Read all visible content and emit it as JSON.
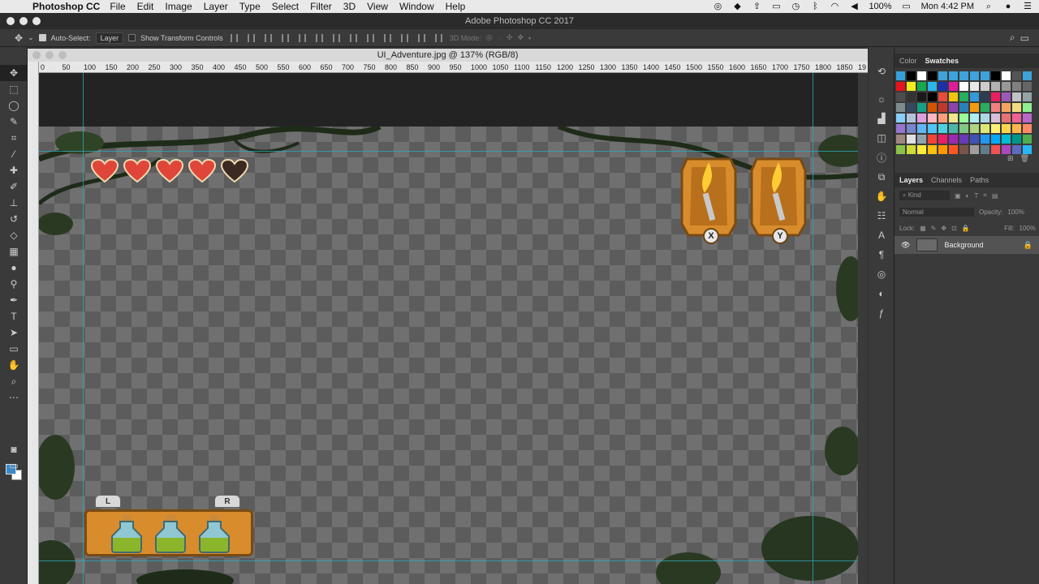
{
  "menubar": {
    "apple_glyph": "",
    "app_name": "Photoshop CC",
    "items": [
      "File",
      "Edit",
      "Image",
      "Layer",
      "Type",
      "Select",
      "Filter",
      "3D",
      "View",
      "Window",
      "Help"
    ],
    "battery": "100%",
    "clock": "Mon 4:42 PM"
  },
  "window": {
    "title": "Adobe Photoshop CC 2017"
  },
  "options": {
    "auto_select_label": "Auto-Select:",
    "auto_select_value": "Layer",
    "transform_controls_label": "Show Transform Controls",
    "mode_3d_label": "3D Mode:"
  },
  "document": {
    "tab_title": "UI_Adventure.jpg @ 137% (RGB/8)",
    "ruler_ticks": [
      "0",
      "50",
      "100",
      "150",
      "200",
      "250",
      "300",
      "350",
      "400",
      "450",
      "500",
      "550",
      "600",
      "650",
      "700",
      "750",
      "800",
      "850",
      "900",
      "950",
      "1000",
      "1050",
      "1100",
      "1150",
      "1200",
      "1250",
      "1300",
      "1350",
      "1400",
      "1450",
      "1500",
      "1550",
      "1600",
      "1650",
      "1700",
      "1750",
      "1800",
      "1850",
      "19"
    ]
  },
  "game_ui": {
    "hearts_full": 4,
    "hearts_total": 5,
    "torch_buttons": [
      "X",
      "Y"
    ],
    "shoulder_buttons": [
      "L",
      "R"
    ],
    "potion_count": 3
  },
  "panels": {
    "color_tabs": [
      "Color",
      "Swatches"
    ],
    "active_color_tab": "Swatches",
    "layer_tabs": [
      "Layers",
      "Channels",
      "Paths"
    ],
    "active_layer_tab": "Layers",
    "kind_label": "Kind",
    "blend_mode": "Normal",
    "opacity_label": "Opacity:",
    "opacity_value": "100%",
    "lock_label": "Lock:",
    "fill_label": "Fill:",
    "fill_value": "100%",
    "layer_name": "Background"
  },
  "colors": {
    "foreground": "#3a88c8",
    "background": "#ffffff",
    "swatches": [
      "#38a0d8",
      "#000000",
      "#ffffff",
      "#000000",
      "#3fa2da",
      "#3fa2da",
      "#3fa2da",
      "#3fa2da",
      "#3fa2da",
      "#000000",
      "#ffffff",
      "#555555",
      "#3fa2da",
      "#e8141c",
      "#f4eb1c",
      "#16a84b",
      "#2ab6e8",
      "#1c2fa8",
      "#e01c9a",
      "#ffffff",
      "#e8e8e8",
      "#cccccc",
      "#b2b2b2",
      "#999999",
      "#808080",
      "#666666",
      "#4d4d4d",
      "#333333",
      "#1a1a1a",
      "#000000",
      "#e74c3c",
      "#f1c40f",
      "#27ae60",
      "#3498db",
      "#2c3e50",
      "#e91e63",
      "#9b59b6",
      "#bdc3c7",
      "#95a5a6",
      "#7f8c8d",
      "#34495e",
      "#16a085",
      "#d35400",
      "#c0392b",
      "#8e44ad",
      "#2980b9",
      "#f39c12",
      "#27ae60",
      "#f08080",
      "#f4a460",
      "#eedd82",
      "#90ee90",
      "#87cefa",
      "#b0c4de",
      "#dda0dd",
      "#ffb6c1",
      "#ffa07a",
      "#f0e68c",
      "#98fb98",
      "#afeeee",
      "#add8e6",
      "#d8bfd8",
      "#e57373",
      "#f06292",
      "#ba68c8",
      "#9575cd",
      "#7986cb",
      "#64b5f6",
      "#4fc3f7",
      "#4dd0e1",
      "#4db6ac",
      "#81c784",
      "#aed581",
      "#dce775",
      "#fff176",
      "#ffd54f",
      "#ffb74d",
      "#ff8a65",
      "#a1887f",
      "#e0e0e0",
      "#90a4ae",
      "#f44336",
      "#e91e63",
      "#9c27b0",
      "#673ab7",
      "#3f51b5",
      "#2196f3",
      "#03a9f4",
      "#00bcd4",
      "#009688",
      "#4caf50",
      "#8bc34a",
      "#cddc39",
      "#ffeb3b",
      "#ffc107",
      "#ff9800",
      "#ff5722",
      "#795548",
      "#9e9e9e",
      "#607d8b",
      "#ef5350",
      "#ab47bc",
      "#5c6bc0",
      "#29b6f6"
    ]
  }
}
